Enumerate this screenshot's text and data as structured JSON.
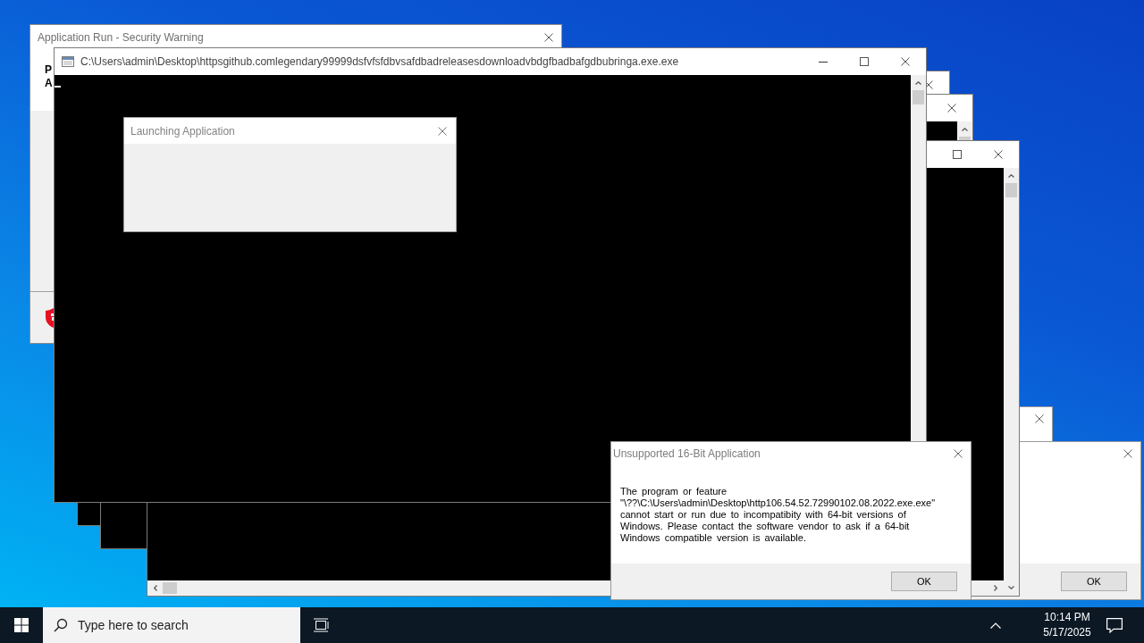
{
  "windows": [
    {
      "kind": "security",
      "title": "Application Run - Security Warning",
      "lines": [
        "P",
        "A"
      ]
    },
    {
      "kind": "console",
      "title": "C:\\Users\\admin\\Desktop\\httpsgithub.comlegendary99999dsfvfsfdbvsafdbadreleasesdownloadvbdgfbadbafgdbubringa.exe.exe"
    },
    {
      "kind": "blank",
      "title": "Launching Application"
    },
    {
      "kind": "console"
    },
    {
      "kind": "console"
    },
    {
      "kind": "console"
    },
    {
      "kind": "dialog"
    },
    {
      "kind": "dialog",
      "title": "Unsupported 16-Bit Application",
      "message": "The program or feature \"\\??\\C:\\Users\\admin\\Desktop\\http106.54.52.72990102.08.2022.exe.exe\" cannot start or run due to incompatibity with 64-bit versions of Windows. Please contact the software vendor to ask if a 64-bit Windows compatible version is available.",
      "button": "OK"
    },
    {
      "kind": "dialog",
      "button": "OK"
    }
  ],
  "taskbar": {
    "search": {
      "placeholder": "Type here to search"
    },
    "clock": {
      "time": "10:14 PM",
      "date": "5/17/2025"
    }
  }
}
